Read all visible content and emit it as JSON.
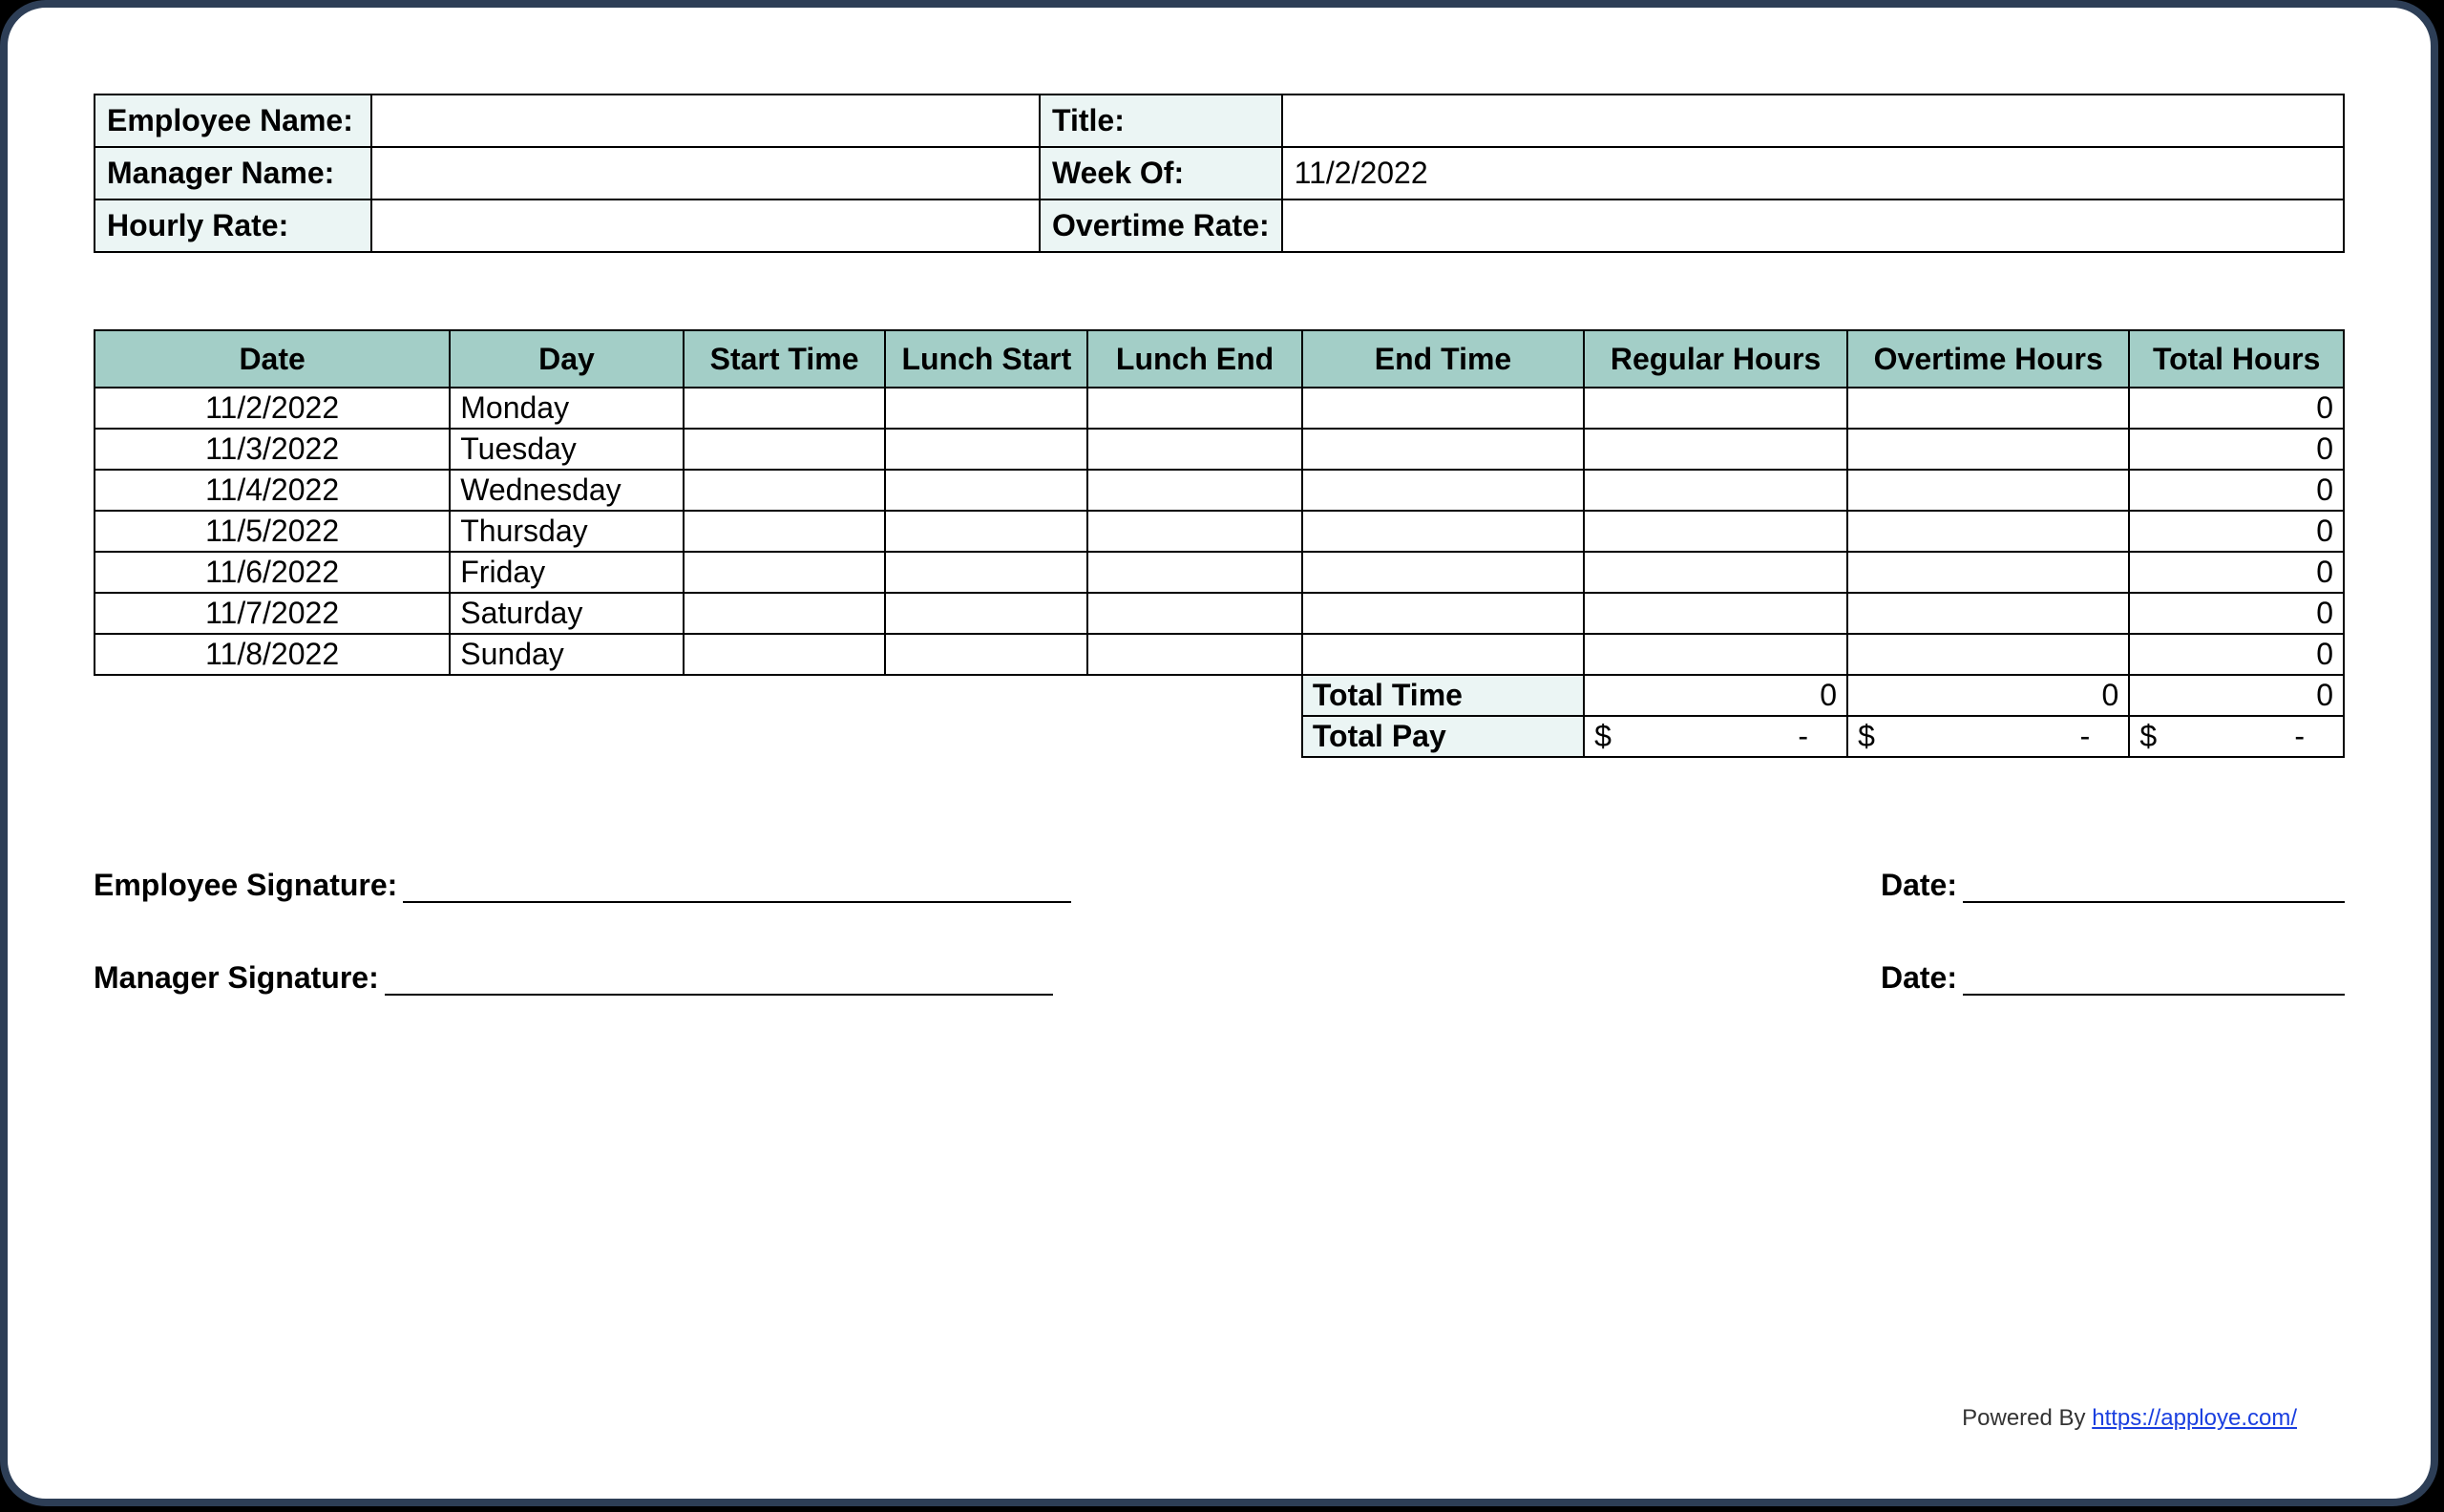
{
  "header": {
    "employee_name_label": "Employee Name:",
    "employee_name_value": "",
    "title_label": "Title:",
    "title_value": "",
    "manager_name_label": "Manager Name:",
    "manager_name_value": "",
    "week_of_label": "Week Of:",
    "week_of_value": "11/2/2022",
    "hourly_rate_label": "Hourly Rate:",
    "hourly_rate_value": "",
    "overtime_rate_label": "Overtime Rate:",
    "overtime_rate_value": ""
  },
  "columns": {
    "date": "Date",
    "day": "Day",
    "start": "Start Time",
    "lunch_start": "Lunch Start",
    "lunch_end": "Lunch End",
    "end": "End Time",
    "regular": "Regular Hours",
    "overtime": "Overtime Hours",
    "total": "Total Hours"
  },
  "rows": [
    {
      "date": "11/2/2022",
      "day": "Monday",
      "start": "",
      "lunch_start": "",
      "lunch_end": "",
      "end": "",
      "regular": "",
      "overtime": "",
      "total": "0"
    },
    {
      "date": "11/3/2022",
      "day": "Tuesday",
      "start": "",
      "lunch_start": "",
      "lunch_end": "",
      "end": "",
      "regular": "",
      "overtime": "",
      "total": "0"
    },
    {
      "date": "11/4/2022",
      "day": "Wednesday",
      "start": "",
      "lunch_start": "",
      "lunch_end": "",
      "end": "",
      "regular": "",
      "overtime": "",
      "total": "0"
    },
    {
      "date": "11/5/2022",
      "day": "Thursday",
      "start": "",
      "lunch_start": "",
      "lunch_end": "",
      "end": "",
      "regular": "",
      "overtime": "",
      "total": "0"
    },
    {
      "date": "11/6/2022",
      "day": "Friday",
      "start": "",
      "lunch_start": "",
      "lunch_end": "",
      "end": "",
      "regular": "",
      "overtime": "",
      "total": "0"
    },
    {
      "date": "11/7/2022",
      "day": "Saturday",
      "start": "",
      "lunch_start": "",
      "lunch_end": "",
      "end": "",
      "regular": "",
      "overtime": "",
      "total": "0"
    },
    {
      "date": "11/8/2022",
      "day": "Sunday",
      "start": "",
      "lunch_start": "",
      "lunch_end": "",
      "end": "",
      "regular": "",
      "overtime": "",
      "total": "0"
    }
  ],
  "summary": {
    "total_time_label": "Total Time",
    "total_time_regular": "0",
    "total_time_overtime": "0",
    "total_time_total": "0",
    "total_pay_label": "Total Pay",
    "pay_regular_currency": "$",
    "pay_regular_value": "-",
    "pay_overtime_currency": "$",
    "pay_overtime_value": "-",
    "pay_total_currency": "$",
    "pay_total_value": "-"
  },
  "signatures": {
    "employee_label": "Employee Signature:",
    "manager_label": "Manager Signature:",
    "date_label": "Date:"
  },
  "footer": {
    "powered_by": "Powered By ",
    "link_text": "https://apploye.com/"
  }
}
